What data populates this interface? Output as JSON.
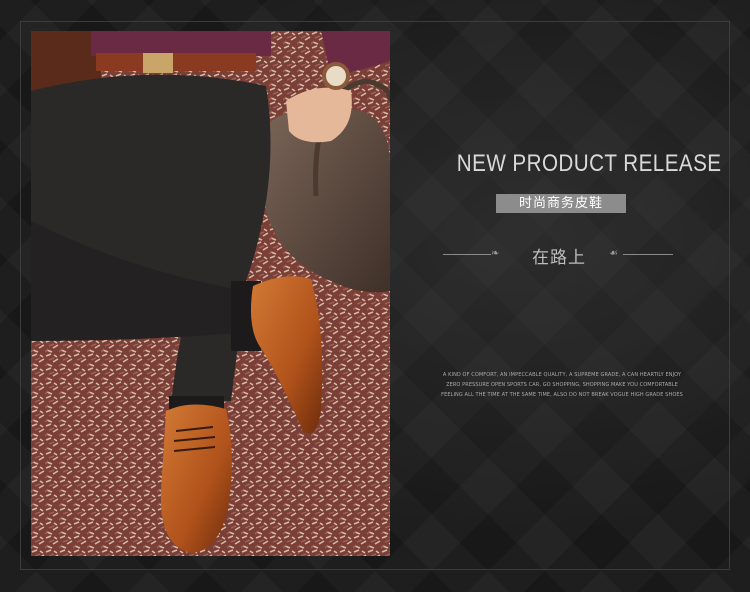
{
  "headline": "NEW PRODUCT RELEASE",
  "subtitle": "时尚商务皮鞋",
  "tagline": "在路上",
  "blurb": "A KIND OF COMFORT, AN IMPECCABLE QUALITY, A SUPREME GRADE, A CAN HEARTILY ENJOY ZERO PRESSURE OPEN SPORTS CAR, GO SHOPPING, SHOPPING MAKE YOU COMFORTABLE FEELING ALL THE TIME AT THE SAME TIME, ALSO DO NOT BREAK VOGUE HIGH GRADE SHOES",
  "photo": {
    "icon": "product-photo-shoes"
  },
  "colors": {
    "background": "#1a1a1a",
    "subtitle_bg": "#8c8c8c",
    "shoe": "#b8561c",
    "rug": "#8a5048",
    "trousers": "#2a2828"
  }
}
